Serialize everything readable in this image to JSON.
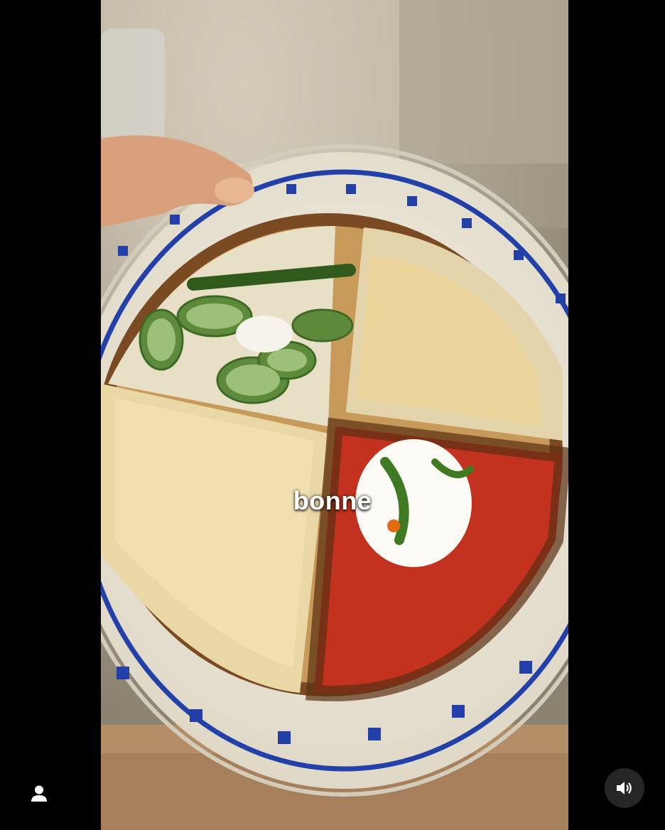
{
  "video": {
    "caption": "bonne",
    "description_hidden": ""
  },
  "controls": {
    "user_icon": "user-icon",
    "sound_icon": "speaker-on-icon"
  },
  "colors": {
    "background": "#000000",
    "plate_rim_blue": "#2340a8",
    "control_bg": "#262626"
  }
}
